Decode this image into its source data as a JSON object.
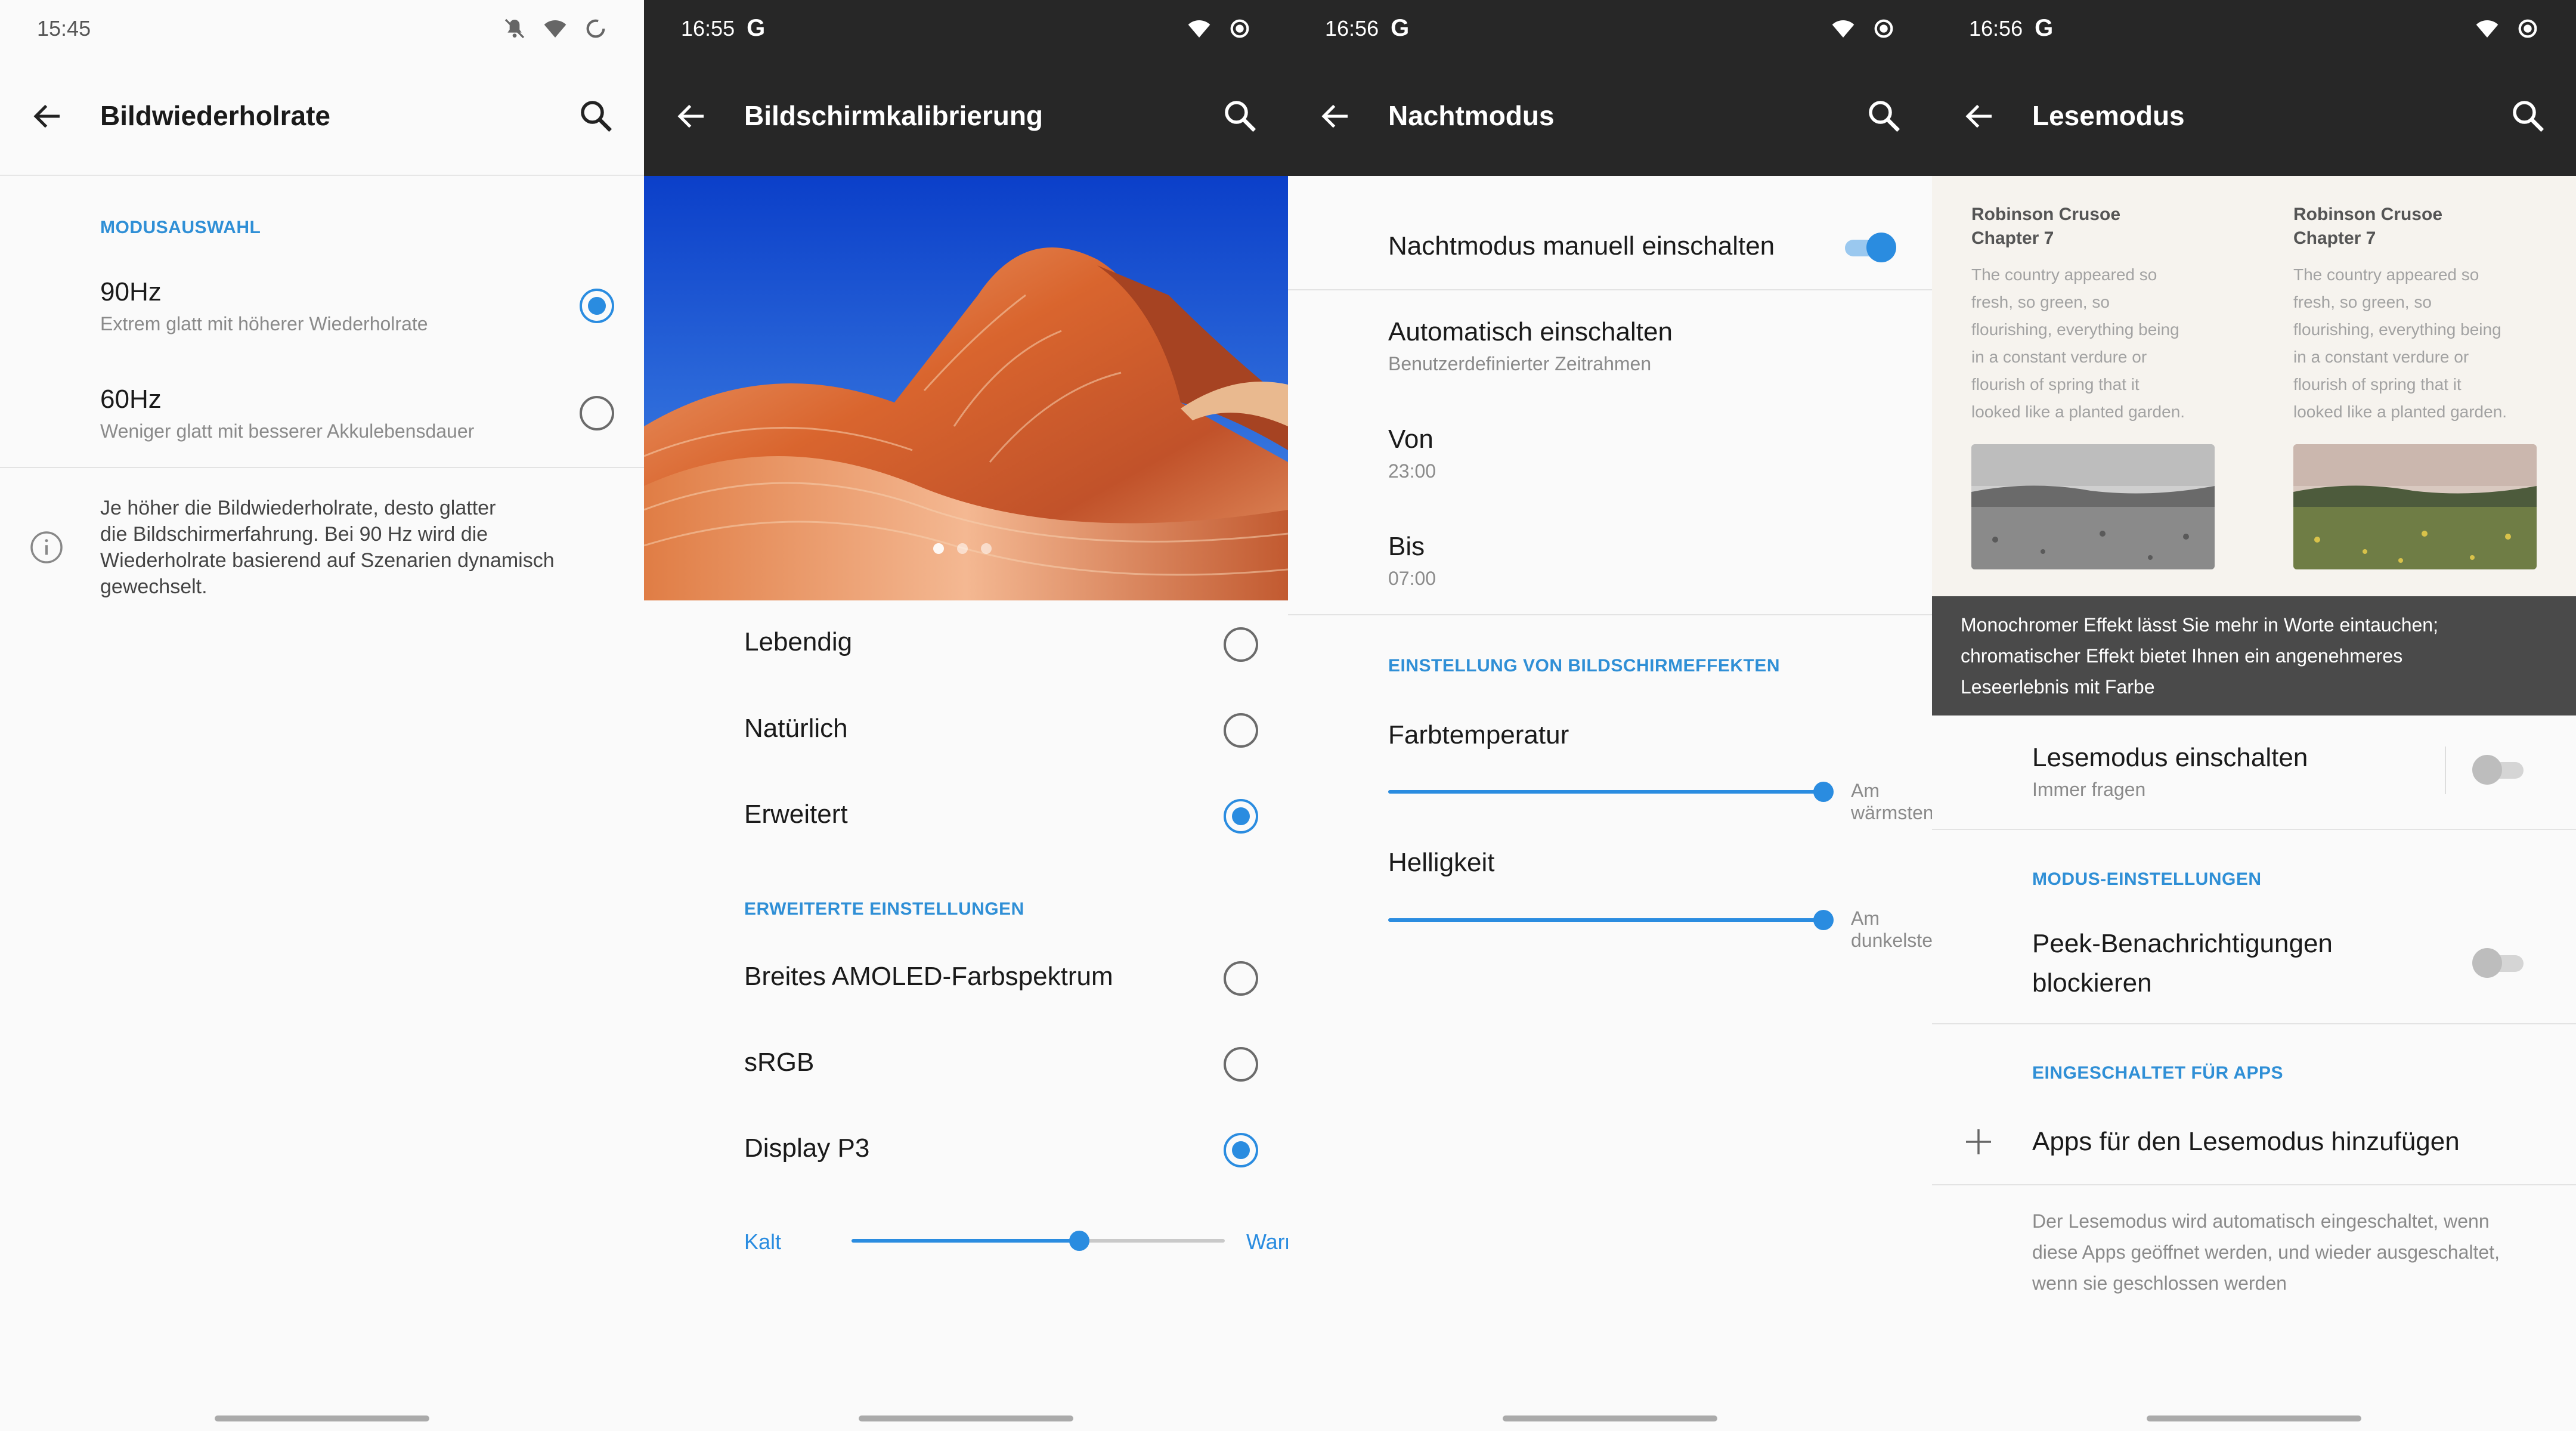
{
  "screens": [
    {
      "time": "15:45",
      "title": "Bildwiederholrate",
      "section": "MODUSAUSWAHL",
      "options": [
        {
          "label": "90Hz",
          "sub": "Extrem glatt mit höherer Wiederholrate",
          "selected": true
        },
        {
          "label": "60Hz",
          "sub": "Weniger glatt mit besserer Akkulebensdauer",
          "selected": false
        }
      ],
      "info_lines": [
        "Je höher die Bildwiederholrate, desto glatter",
        "die Bildschirmerfahrung. Bei 90 Hz wird die",
        "Wiederholrate basierend auf Szenarien dynamisch",
        "gewechselt."
      ]
    },
    {
      "time": "16:55",
      "title": "Bildschirmkalibrierung",
      "modes": [
        {
          "label": "Lebendig",
          "selected": false
        },
        {
          "label": "Natürlich",
          "selected": false
        },
        {
          "label": "Erweitert",
          "selected": true
        }
      ],
      "section": "ERWEITERTE EINSTELLUNGEN",
      "advanced": [
        {
          "label": "Breites AMOLED-Farbspektrum",
          "selected": false
        },
        {
          "label": "sRGB",
          "selected": false
        },
        {
          "label": "Display P3",
          "selected": true
        }
      ],
      "slider_left": "Kalt",
      "slider_right": "Warm",
      "slider_value": 0.61,
      "carousel_page": 1,
      "carousel_count": 3
    },
    {
      "time": "16:56",
      "title": "Nachtmodus",
      "manual_label": "Nachtmodus manuell einschalten",
      "manual_on": true,
      "auto_label": "Automatisch einschalten",
      "auto_sub": "Benutzerdefinierter Zeitrahmen",
      "from_label": "Von",
      "from_value": "23:00",
      "to_label": "Bis",
      "to_value": "07:00",
      "section": "EINSTELLUNG VON BILDSCHIRMEFFEKTEN",
      "temp_label": "Farbtemperatur",
      "temp_end": "Am wärmsten",
      "temp_value": 1.0,
      "bright_label": "Helligkeit",
      "bright_end": "Am dunkelsten",
      "bright_value": 1.0
    },
    {
      "time": "16:56",
      "title": "Lesemodus",
      "books": [
        {
          "title1": "Robinson Crusoe",
          "title2": "Chapter 7",
          "lines": [
            "The country appeared so",
            "fresh, so green, so",
            "flourishing, everything being",
            "in a constant verdure or",
            "flourish of spring that it",
            "looked like a planted garden."
          ]
        },
        {
          "title1": "Robinson Crusoe",
          "title2": "Chapter 7",
          "lines": [
            "The country appeared so",
            "fresh, so green, so",
            "flourishing, everything being",
            "in a constant verdure or",
            "flourish of spring that it",
            "looked like a planted garden."
          ]
        }
      ],
      "tip_lines": [
        "Monochromer Effekt lässt Sie mehr in Worte eintauchen;",
        "chromatischer Effekt bietet Ihnen ein angenehmeres",
        "Leseerlebnis mit Farbe"
      ],
      "enable_label": "Lesemodus einschalten",
      "enable_sub": "Immer fragen",
      "section1": "MODUS-EINSTELLUNGEN",
      "peek_line1": "Peek-Benachrichtigungen",
      "peek_line2": "blockieren",
      "section2": "EINGESCHALTET FÜR APPS",
      "add_apps": "Apps für den Lesemodus hinzufügen",
      "footer_lines": [
        "Der Lesemodus wird automatisch eingeschaltet, wenn",
        "diese Apps geöffnet werden, und wieder ausgeschaltet,",
        "wenn sie geschlossen werden"
      ]
    }
  ],
  "colors": {
    "accent": "#2a8ce0",
    "dark_bar": "#272727",
    "background": "#fafafa"
  },
  "icons": [
    "back-arrow-icon",
    "search-icon",
    "wifi-icon",
    "mute-icon",
    "battery-icon",
    "google-icon",
    "info-icon",
    "plus-icon"
  ]
}
